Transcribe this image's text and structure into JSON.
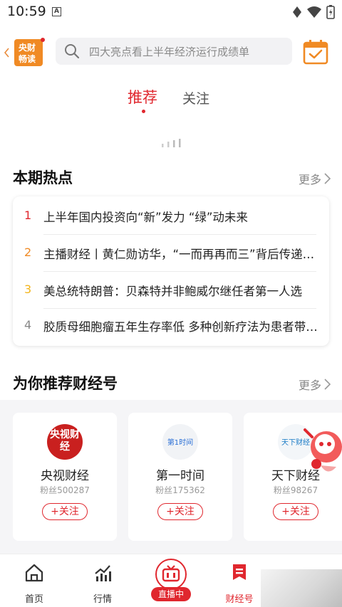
{
  "status_bar": {
    "time": "10:59",
    "notif_letter": "A"
  },
  "header": {
    "logo_text_line1": "央财",
    "logo_text_line2": "畅读",
    "search_placeholder": "四大亮点看上半年经济运行成绩单"
  },
  "tabs": [
    {
      "label": "推荐",
      "active": true
    },
    {
      "label": "关注",
      "active": false
    }
  ],
  "hot": {
    "title": "本期热点",
    "more": "更多",
    "items": [
      {
        "rank": "1",
        "text": "上半年国内投资向“新”发力 “绿”动未来",
        "color": "#e0272e"
      },
      {
        "rank": "2",
        "text": "主播财经丨黄仁勋访华，“一而再再而三”背后传递的信号",
        "color": "#f08a24"
      },
      {
        "rank": "3",
        "text": "美总统特朗普：贝森特并非鲍威尔继任者第一人选",
        "color": "#f2b51d"
      },
      {
        "rank": "4",
        "text": "胶质母细胞瘤五年生存率低 多种创新疗法为患者带来希望",
        "color": "#888888"
      }
    ]
  },
  "recommend": {
    "title": "为你推荐财经号",
    "more": "更多",
    "accounts": [
      {
        "name": "央视财经",
        "fans": "粉丝500287",
        "follow": "+关注",
        "logo_text": "央视财经"
      },
      {
        "name": "第一时间",
        "fans": "粉丝175362",
        "follow": "+关注",
        "logo_text": "第1时间"
      },
      {
        "name": "天下财经",
        "fans": "粉丝98267",
        "follow": "+关注",
        "logo_text": "天下财经"
      }
    ]
  },
  "bottom_nav": [
    {
      "label": "首页",
      "icon": "home-icon"
    },
    {
      "label": "行情",
      "icon": "chart-icon"
    },
    {
      "label": "直播中",
      "icon": "tv-icon"
    },
    {
      "label": "财经号",
      "icon": "bookmark-icon"
    }
  ],
  "colors": {
    "accent": "#e0272e",
    "orange": "#f08a24"
  }
}
